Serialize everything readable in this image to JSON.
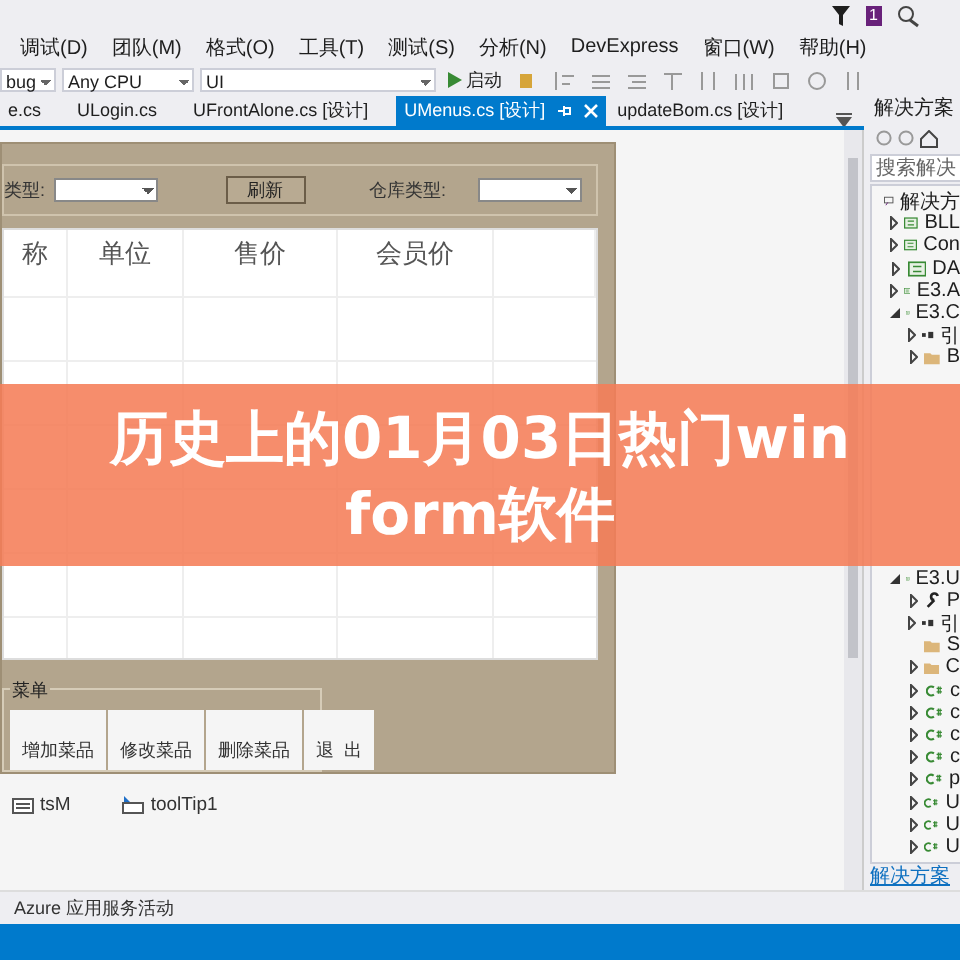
{
  "title_bar": {
    "notification_count": "1"
  },
  "menu": [
    "调试(D)",
    "团队(M)",
    "格式(O)",
    "工具(T)",
    "测试(S)",
    "分析(N)",
    "DevExpress",
    "窗口(W)",
    "帮助(H)"
  ],
  "toolbar": {
    "configuration": "bug",
    "platform": "Any CPU",
    "project": "UI",
    "start_label": "启动"
  },
  "tabs": [
    {
      "label": "e.cs",
      "selected": false
    },
    {
      "label": "ULogin.cs",
      "selected": false
    },
    {
      "label": "UFrontAlone.cs [设计]",
      "selected": false
    },
    {
      "label": "UMenus.cs [设计]",
      "selected": true
    },
    {
      "label": "updateBom.cs [设计]",
      "selected": false
    }
  ],
  "form": {
    "filter_label": "类型:",
    "refresh_button": "刷新",
    "warehouse_label": "仓库类型:",
    "columns": [
      "称",
      "单位",
      "售价",
      "会员价"
    ],
    "menu_group": {
      "title": "菜单",
      "buttons": [
        "增加菜品",
        "修改菜品",
        "删除菜品",
        "退  出"
      ]
    }
  },
  "component_tray": [
    {
      "label": "tsM",
      "kind": "strip"
    },
    {
      "label": "toolTip1",
      "kind": "tooltip"
    }
  ],
  "solution_explorer": {
    "title": "解决方案",
    "search_placeholder": "搜索解决",
    "footer_link": "解决方案",
    "tree": [
      {
        "label": "解决方",
        "kind": "solution",
        "children": [
          {
            "label": "BLL",
            "kind": "project",
            "expanded": false
          },
          {
            "label": "Con",
            "kind": "project",
            "expanded": false
          },
          {
            "label": "DA",
            "kind": "project",
            "expanded": false
          },
          {
            "label": "E3.A",
            "kind": "project",
            "expanded": false
          },
          {
            "label": "E3.C",
            "kind": "project",
            "expanded": true,
            "children": [
              {
                "label": "引",
                "kind": "refs",
                "expanded": false
              },
              {
                "label": "B",
                "kind": "folder",
                "expanded": false
              }
            ]
          },
          {
            "label": "E3.U",
            "kind": "project",
            "expanded": true,
            "children": [
              {
                "label": "P",
                "kind": "wrench",
                "expanded": false
              },
              {
                "label": "引",
                "kind": "refs",
                "expanded": false
              },
              {
                "label": "S",
                "kind": "folder"
              },
              {
                "label": "C",
                "kind": "folder",
                "expanded": false
              },
              {
                "label": "c",
                "kind": "csharp",
                "expanded": false
              },
              {
                "label": "c",
                "kind": "csharp",
                "expanded": false
              },
              {
                "label": "c",
                "kind": "csharp",
                "expanded": false
              },
              {
                "label": "c",
                "kind": "csharp",
                "expanded": false
              },
              {
                "label": "p",
                "kind": "csharp",
                "expanded": false
              },
              {
                "label": "U",
                "kind": "csharp",
                "expanded": false
              },
              {
                "label": "U",
                "kind": "csharp",
                "expanded": false
              },
              {
                "label": "U",
                "kind": "csharp",
                "expanded": false
              }
            ]
          }
        ]
      }
    ]
  },
  "output_tab": "Azure 应用服务活动",
  "banner": {
    "lines": [
      "历史上的01月03日热门win",
      "form软件"
    ]
  }
}
